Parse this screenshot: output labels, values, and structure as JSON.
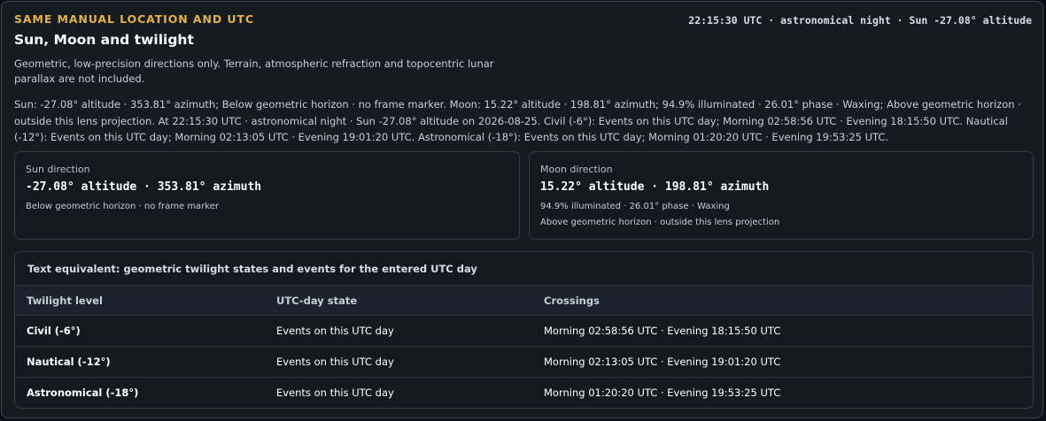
{
  "header": {
    "kicker": "SAME MANUAL LOCATION AND UTC",
    "status": "22:15:30 UTC · astronomical night · Sun -27.08° altitude",
    "title": "Sun, Moon and twilight",
    "note": "Geometric, low-precision directions only. Terrain, atmospheric refraction and topocentric lunar parallax are not included.",
    "summary": "Sun: -27.08° altitude · 353.81° azimuth; Below geometric horizon · no frame marker. Moon: 15.22° altitude · 198.81° azimuth; 94.9% illuminated · 26.01° phase · Waxing; Above geometric horizon · outside this lens projection. At 22:15:30 UTC · astronomical night · Sun -27.08° altitude on 2026-08-25. Civil (-6°): Events on this UTC day; Morning 02:58:56 UTC · Evening 18:15:50 UTC. Nautical (-12°): Events on this UTC day; Morning 02:13:05 UTC · Evening 19:01:20 UTC. Astronomical (-18°): Events on this UTC day; Morning 01:20:20 UTC · Evening 19:53:25 UTC."
  },
  "sun": {
    "label": "Sun direction",
    "value": "-27.08° altitude · 353.81° azimuth",
    "detail": "Below geometric horizon · no frame marker"
  },
  "moon": {
    "label": "Moon direction",
    "value": "15.22° altitude · 198.81° azimuth",
    "detail1": "94.9% illuminated · 26.01° phase · Waxing",
    "detail2": "Above geometric horizon · outside this lens projection"
  },
  "table": {
    "caption": "Text equivalent: geometric twilight states and events for the entered UTC day",
    "headers": [
      "Twilight level",
      "UTC-day state",
      "Crossings"
    ],
    "rows": [
      {
        "level": "Civil (-6°)",
        "state": "Events on this UTC day",
        "crossings": "Morning 02:58:56 UTC · Evening 18:15:50 UTC"
      },
      {
        "level": "Nautical (-12°)",
        "state": "Events on this UTC day",
        "crossings": "Morning 02:13:05 UTC · Evening 19:01:20 UTC"
      },
      {
        "level": "Astronomical (-18°)",
        "state": "Events on this UTC day",
        "crossings": "Morning 01:20:20 UTC · Evening 19:53:25 UTC"
      }
    ]
  },
  "colors": {
    "accent": "#e3b341",
    "background": "#0d1117",
    "panel": "#161b22"
  }
}
